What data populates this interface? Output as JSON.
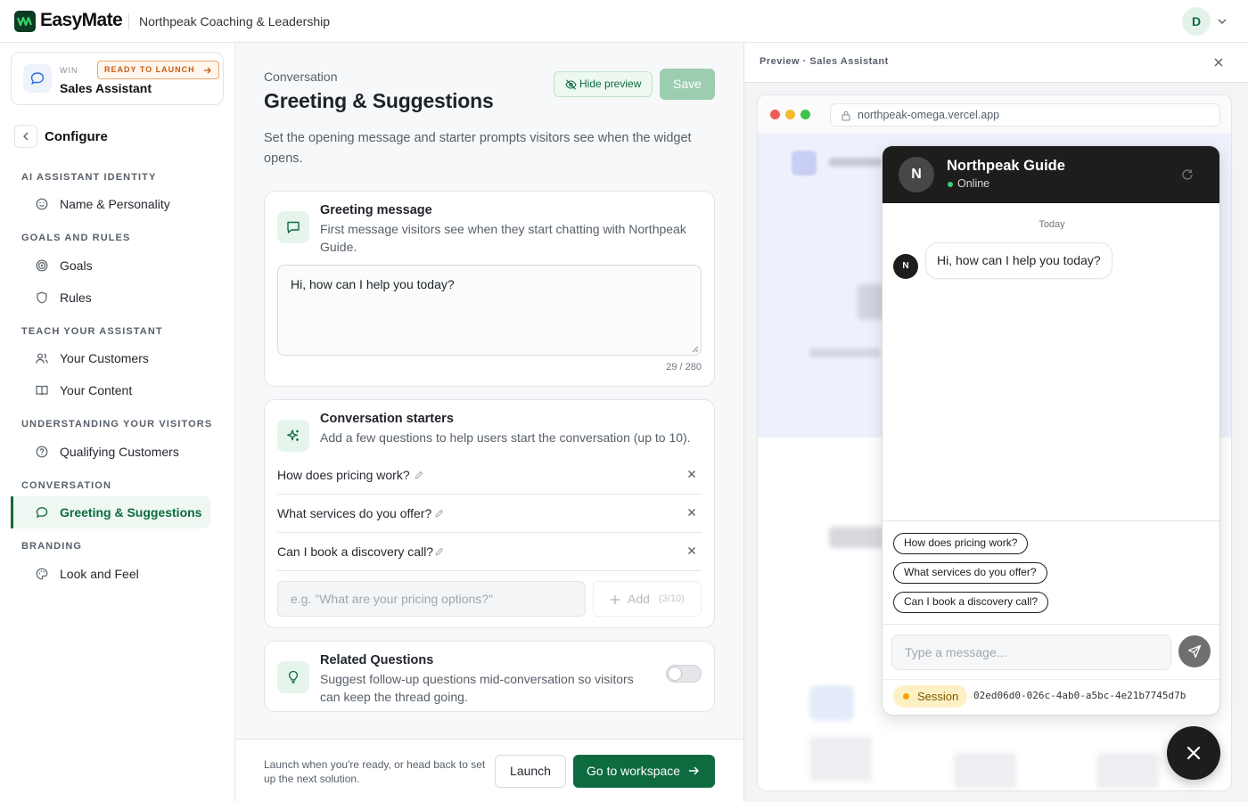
{
  "topbar": {
    "brand": "EasyMate",
    "org": "Northpeak Coaching & Leadership",
    "avatar_initial": "D"
  },
  "sidebar": {
    "solution": {
      "tag": "WIN",
      "status": "READY TO LAUNCH",
      "name": "Sales Assistant"
    },
    "configure_label": "Configure",
    "sections": [
      {
        "title": "AI ASSISTANT IDENTITY",
        "items": [
          {
            "label": "Name & Personality",
            "icon": "smile-icon"
          }
        ]
      },
      {
        "title": "GOALS AND RULES",
        "items": [
          {
            "label": "Goals",
            "icon": "target-icon"
          },
          {
            "label": "Rules",
            "icon": "shield-icon"
          }
        ]
      },
      {
        "title": "TEACH YOUR ASSISTANT",
        "items": [
          {
            "label": "Your Customers",
            "icon": "users-icon"
          },
          {
            "label": "Your Content",
            "icon": "book-icon"
          }
        ]
      },
      {
        "title": "UNDERSTANDING YOUR VISITORS",
        "items": [
          {
            "label": "Qualifying Customers",
            "icon": "help-circle-icon"
          }
        ]
      },
      {
        "title": "CONVERSATION",
        "items": [
          {
            "label": "Greeting & Suggestions",
            "icon": "chat-bubble-icon",
            "active": true
          }
        ]
      },
      {
        "title": "BRANDING",
        "items": [
          {
            "label": "Look and Feel",
            "icon": "palette-icon"
          }
        ]
      }
    ]
  },
  "main": {
    "breadcrumb": "Conversation",
    "title": "Greeting & Suggestions",
    "hide_preview_label": "Hide preview",
    "save_label": "Save",
    "description": "Set the opening message and starter prompts visitors see when the widget opens.",
    "greeting": {
      "title": "Greeting message",
      "subtitle": "First message visitors see when they start chatting with Northpeak Guide.",
      "value": "Hi, how can I help you today?",
      "count": "29 / 280"
    },
    "starters": {
      "title": "Conversation starters",
      "subtitle": "Add a few questions to help users start the conversation (up to 10).",
      "items": [
        "How does pricing work?",
        "What services do you offer?",
        "Can I book a discovery call?"
      ],
      "placeholder": "e.g. \"What are your pricing options?\"",
      "add_label": "Add",
      "add_count": "(3/10)"
    },
    "related": {
      "title": "Related Questions",
      "subtitle": "Suggest follow-up questions mid-conversation so visitors can keep the thread going.",
      "enabled": false
    },
    "footer": {
      "text": "Launch when you're ready, or head back to set up the next solution.",
      "launch_label": "Launch",
      "workspace_label": "Go to workspace"
    }
  },
  "preview": {
    "title": "Preview · Sales Assistant",
    "url": "northpeak-omega.vercel.app",
    "chat": {
      "bot_name": "Northpeak Guide",
      "bot_initial": "N",
      "status": "Online",
      "day_label": "Today",
      "greeting": "Hi, how can I help you today?",
      "chips": [
        "How does pricing work?",
        "What services do you offer?",
        "Can I book a discovery call?"
      ],
      "input_placeholder": "Type a message...",
      "session_label": "Session",
      "session_id": "02ed06d0-026c-4ab0-a5bc-4e21b7745d7b"
    }
  },
  "colors": {
    "accent": "#0e6b3f",
    "chat_header": "#1d1d1d",
    "ready_badge": "#c75c12",
    "session_badge": "#fdf0c4"
  }
}
